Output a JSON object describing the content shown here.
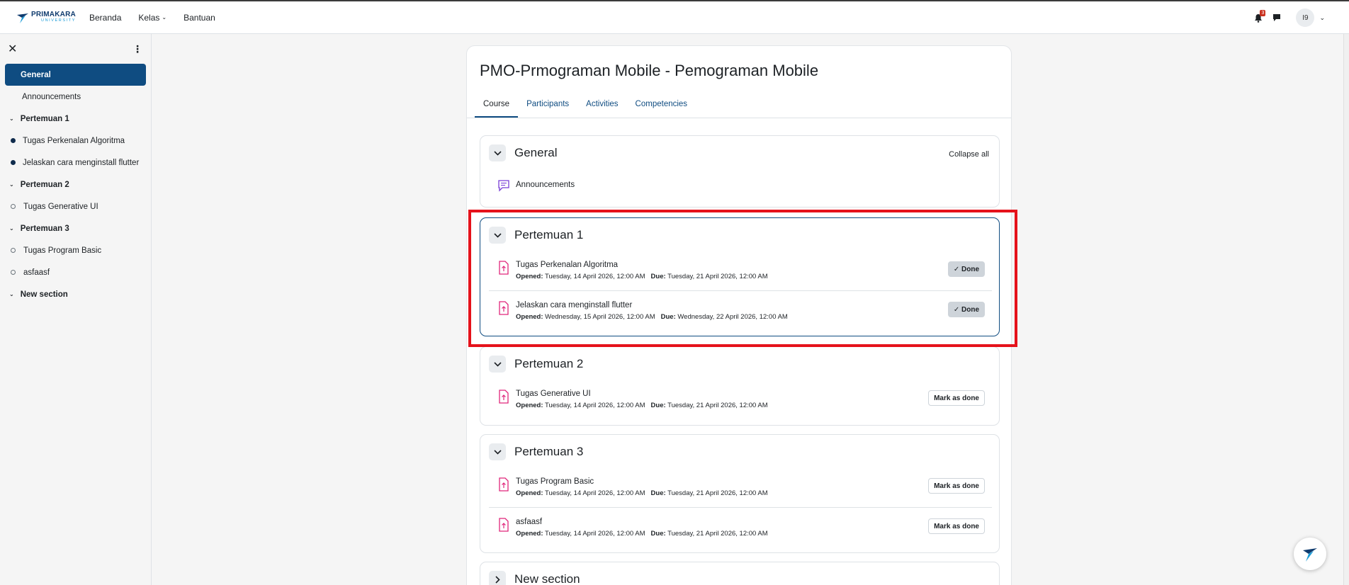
{
  "navbar": {
    "brand_name": "PRIMAKARA",
    "brand_sub": "UNIVERSITY",
    "links": [
      {
        "label": "Beranda"
      },
      {
        "label": "Kelas"
      },
      {
        "label": "Bantuan"
      }
    ],
    "notification_count": "3",
    "avatar_initials": "I9",
    "icons": [
      "bell-icon",
      "chat-icon",
      "chevron-down-icon"
    ]
  },
  "drawer": {
    "items": [
      {
        "label": "General"
      },
      {
        "label": "Announcements"
      },
      {
        "label": "Pertemuan 1"
      },
      {
        "label": "Tugas Perkenalan Algoritma"
      },
      {
        "label": "Jelaskan cara menginstall flutter"
      },
      {
        "label": "Pertemuan 2"
      },
      {
        "label": "Tugas Generative UI"
      },
      {
        "label": "Pertemuan 3"
      },
      {
        "label": "Tugas Program Basic"
      },
      {
        "label": "asfaasf"
      },
      {
        "label": "New section"
      }
    ]
  },
  "course": {
    "title": "PMO-Prmograman Mobile - Pemograman Mobile",
    "tabs": [
      {
        "label": "Course"
      },
      {
        "label": "Participants"
      },
      {
        "label": "Activities"
      },
      {
        "label": "Competencies"
      }
    ],
    "collapse_all": "Collapse all",
    "opened_label": "Opened:",
    "due_label": "Due:",
    "sections": [
      {
        "title": "General",
        "activities": [
          {
            "name": "Announcements"
          }
        ]
      },
      {
        "title": "Pertemuan 1",
        "activities": [
          {
            "name": "Tugas Perkenalan Algoritma",
            "opened": "Tuesday, 14 April 2026, 12:00 AM",
            "due": "Tuesday, 21 April 2026, 12:00 AM",
            "button": "Done"
          },
          {
            "name": "Jelaskan cara menginstall flutter",
            "opened": "Wednesday, 15 April 2026, 12:00 AM",
            "due": "Wednesday, 22 April 2026, 12:00 AM",
            "button": "Done"
          }
        ]
      },
      {
        "title": "Pertemuan 2",
        "activities": [
          {
            "name": "Tugas Generative UI",
            "opened": "Tuesday, 14 April 2026, 12:00 AM",
            "due": "Tuesday, 21 April 2026, 12:00 AM",
            "button": "Mark as done"
          }
        ]
      },
      {
        "title": "Pertemuan 3",
        "activities": [
          {
            "name": "Tugas Program Basic",
            "opened": "Tuesday, 14 April 2026, 12:00 AM",
            "due": "Tuesday, 21 April 2026, 12:00 AM",
            "button": "Mark as done"
          },
          {
            "name": "asfaasf",
            "opened": "Tuesday, 14 April 2026, 12:00 AM",
            "due": "Tuesday, 21 April 2026, 12:00 AM",
            "button": "Mark as done"
          }
        ]
      },
      {
        "title": "New section",
        "activities": []
      }
    ]
  },
  "colors": {
    "primary": "#0f4c81",
    "assignment_icon": "#e0267b",
    "forum_icon": "#7a3fd6",
    "highlight_box": "#e5121b",
    "badge": "#ca3120"
  }
}
